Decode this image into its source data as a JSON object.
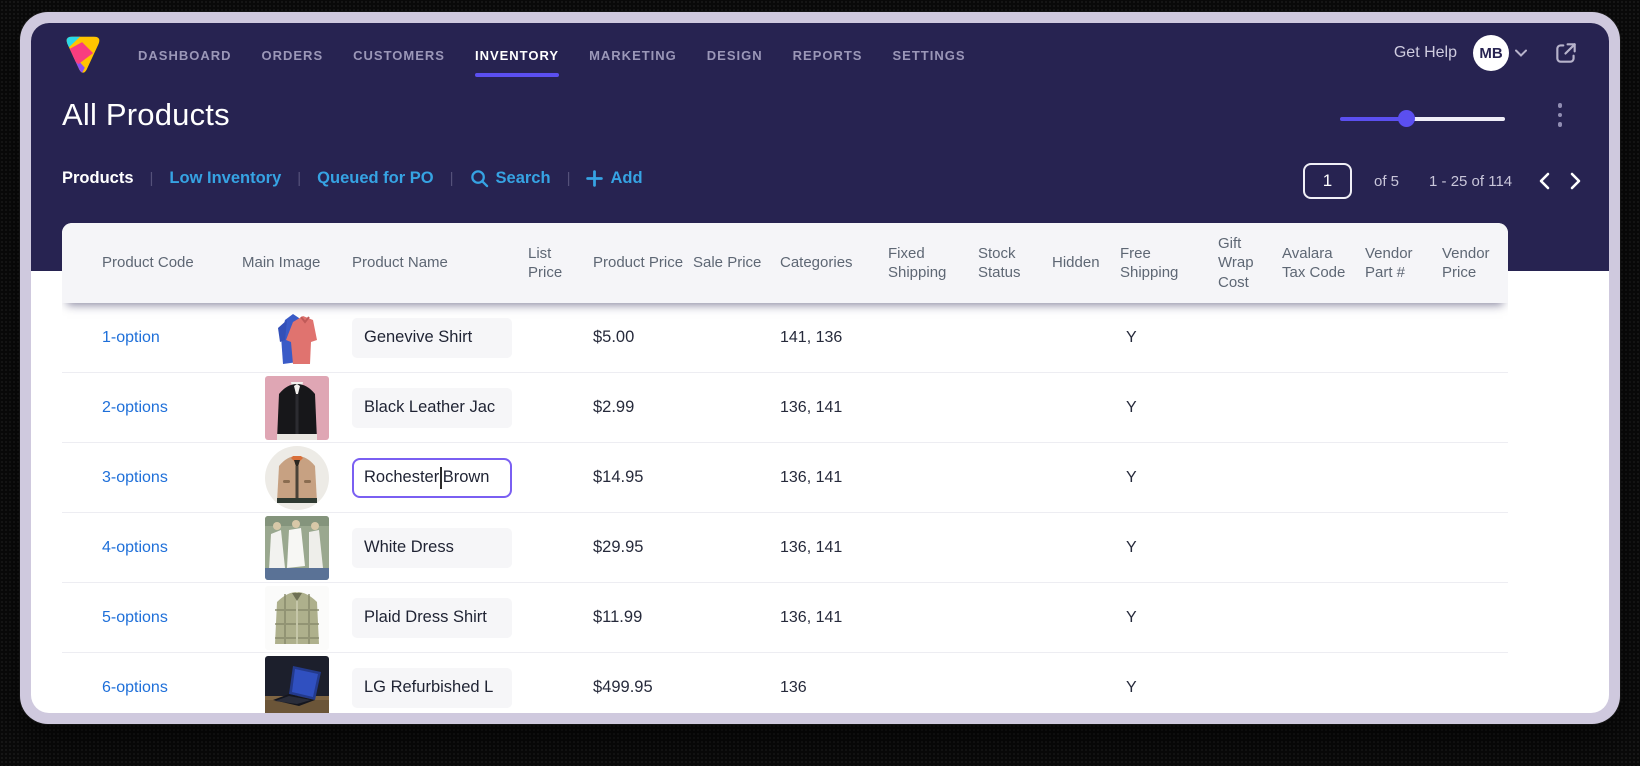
{
  "app": {
    "nav": {
      "items": [
        {
          "label": "DASHBOARD"
        },
        {
          "label": "ORDERS"
        },
        {
          "label": "CUSTOMERS"
        },
        {
          "label": "INVENTORY"
        },
        {
          "label": "MARKETING"
        },
        {
          "label": "DESIGN"
        },
        {
          "label": "REPORTS"
        },
        {
          "label": "SETTINGS"
        }
      ],
      "active_item": "INVENTORY",
      "get_help_label": "Get Help",
      "avatar_initials": "MB"
    },
    "header": {
      "title": "All Products"
    },
    "toolbar": {
      "tabs": [
        {
          "label": "Products",
          "active": true
        },
        {
          "label": "Low Inventory",
          "active": false
        },
        {
          "label": "Queued for PO",
          "active": false
        }
      ],
      "search_label": "Search",
      "add_label": "Add",
      "separator": "|"
    },
    "pagination": {
      "page_value": "1",
      "of_label": "of 5",
      "range_label": "1 - 25 of 114"
    },
    "table": {
      "columns": [
        "Product Code",
        "Main Image",
        "Product Name",
        "List Price",
        "Product Price",
        "Sale Price",
        "Categories",
        "Fixed Shipping",
        "Stock Status",
        "Hidden",
        "Free Shipping",
        "Gift Wrap Cost",
        "Avalara Tax Code",
        "Vendor Part #",
        "Vendor Price"
      ],
      "rows": [
        {
          "product_code": "1-option",
          "product_name": "Genevive Shirt",
          "product_price": "$5.00",
          "categories": "141, 136",
          "free_shipping": "Y",
          "image_alt": "blue-and-coral-shirts"
        },
        {
          "product_code": "2-options",
          "product_name": "Black Leather Jac",
          "product_price": "$2.99",
          "categories": "136, 141",
          "free_shipping": "Y",
          "image_alt": "black-jacket-on-pink"
        },
        {
          "product_code": "3-options",
          "product_name_before_cursor": "Rochester",
          "product_name_after_cursor": "Brown",
          "editing": true,
          "product_price": "$14.95",
          "categories": "136, 141",
          "free_shipping": "Y",
          "image_alt": "brown-suede-jacket"
        },
        {
          "product_code": "4-options",
          "product_name": "White Dress",
          "product_price": "$29.95",
          "categories": "136, 141",
          "free_shipping": "Y",
          "image_alt": "white-dress-models"
        },
        {
          "product_code": "5-options",
          "product_name": "Plaid Dress Shirt",
          "product_price": "$11.99",
          "categories": "136, 141",
          "free_shipping": "Y",
          "image_alt": "plaid-dress-shirt"
        },
        {
          "product_code": "6-options",
          "product_name": "LG Refurbished L",
          "product_price": "$499.95",
          "categories": "136",
          "free_shipping": "Y",
          "image_alt": "lg-laptop"
        }
      ]
    },
    "colors": {
      "navy_background": "#272351",
      "accent_purple": "#5B4FF0",
      "subnav_link_blue": "#36A3E3",
      "table_link_blue": "#1E6FD9",
      "header_text_gray": "#5E6774",
      "cell_text": "#262A3B",
      "active_input_border": "#7A5FF2"
    }
  }
}
